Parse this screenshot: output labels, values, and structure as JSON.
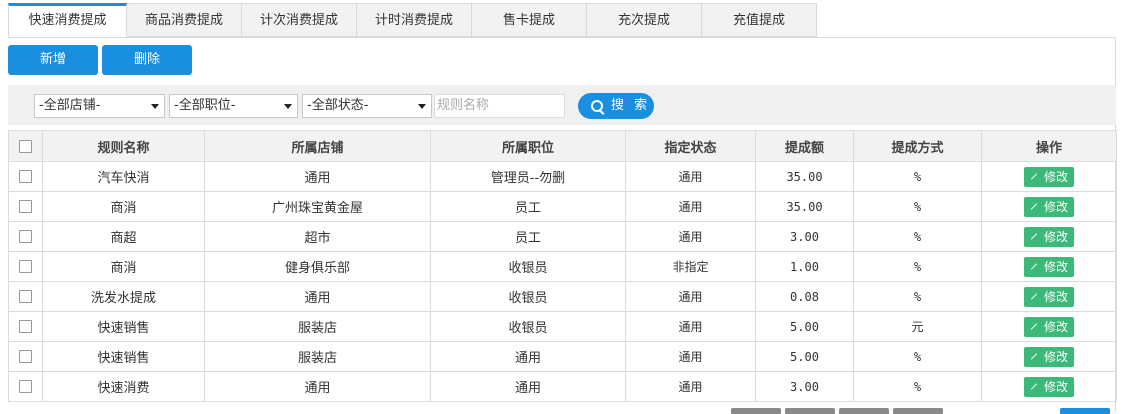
{
  "tabs": [
    "快速消费提成",
    "商品消费提成",
    "计次消费提成",
    "计时消费提成",
    "售卡提成",
    "充次提成",
    "充值提成"
  ],
  "active_tab_index": 0,
  "toolbar": {
    "add_label": "新增",
    "delete_label": "删除"
  },
  "filters": {
    "store": "-全部店铺-",
    "position": "-全部职位-",
    "status": "-全部状态-",
    "rule_placeholder": "规则名称",
    "search_label": "搜 索"
  },
  "table": {
    "headers": [
      "规则名称",
      "所属店铺",
      "所属职位",
      "指定状态",
      "提成额",
      "提成方式",
      "操作"
    ],
    "edit_label": "修改",
    "rows": [
      [
        "汽车快消",
        "通用",
        "管理员--勿删",
        "通用",
        "35.00",
        "%"
      ],
      [
        "商消",
        "广州珠宝黄金屋",
        "员工",
        "通用",
        "35.00",
        "%"
      ],
      [
        "商超",
        "超市",
        "员工",
        "通用",
        "3.00",
        "%"
      ],
      [
        "商消",
        "健身俱乐部",
        "收银员",
        "非指定",
        "1.00",
        "%"
      ],
      [
        "洗发水提成",
        "通用",
        "收银员",
        "通用",
        "0.08",
        "%"
      ],
      [
        "快速销售",
        "服装店",
        "收银员",
        "通用",
        "5.00",
        "元"
      ],
      [
        "快速销售",
        "服装店",
        "通用",
        "通用",
        "5.00",
        "%"
      ],
      [
        "快速消费",
        "通用",
        "通用",
        "通用",
        "3.00",
        "%"
      ]
    ]
  },
  "colors": {
    "primary": "#1a8fe0",
    "edit": "#3cb878",
    "header_bg": "#f2f2f2"
  }
}
